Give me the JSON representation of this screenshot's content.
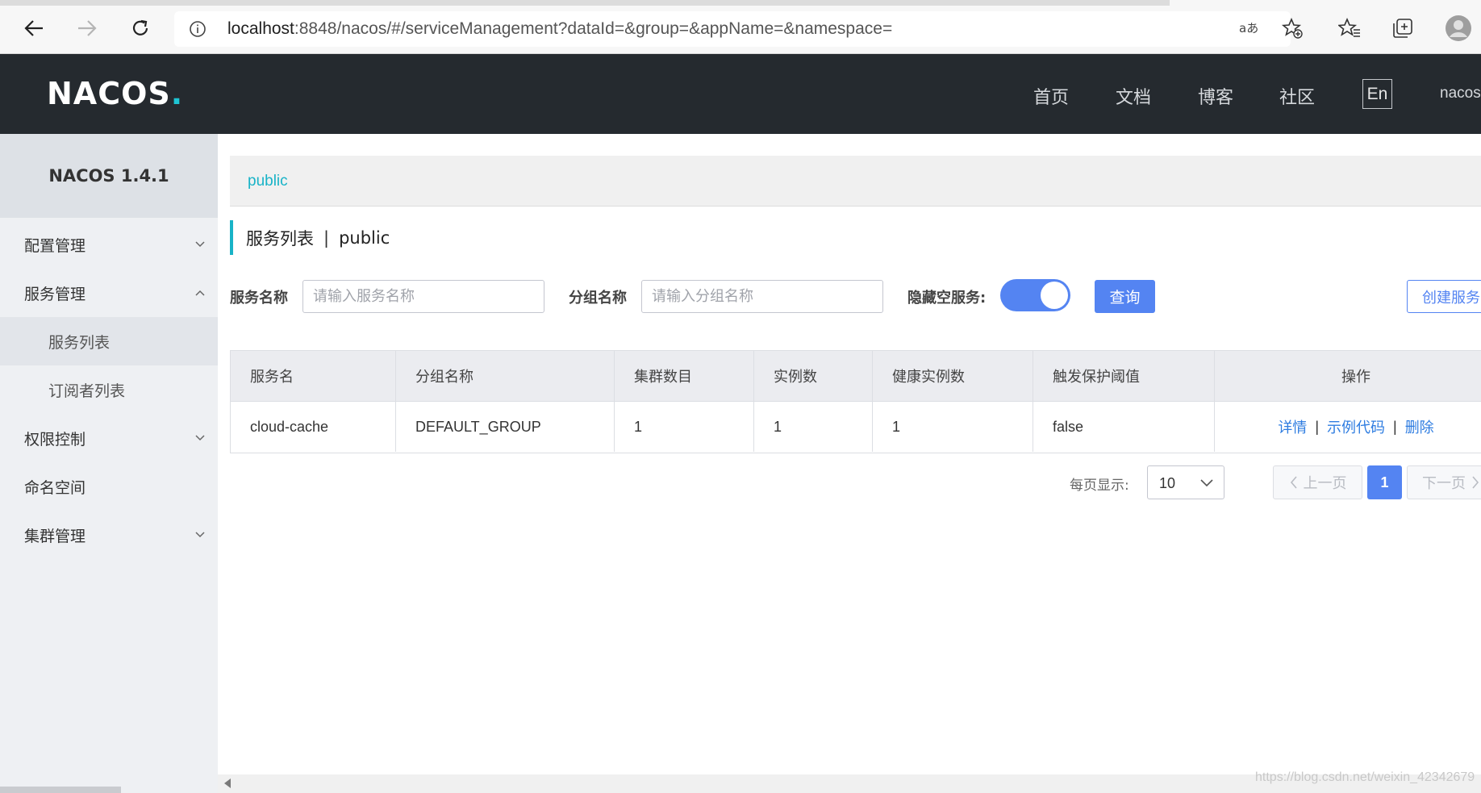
{
  "browser": {
    "url_host": "localhost",
    "url_rest": ":8848/nacos/#/serviceManagement?dataId=&group=&appName=&namespace="
  },
  "header": {
    "logo_text": "NACOS",
    "logo_dot": ".",
    "nav": [
      "首页",
      "文档",
      "博客",
      "社区"
    ],
    "lang_button": "En",
    "user": "nacos"
  },
  "sidebar": {
    "title": "NACOS 1.4.1",
    "items": [
      {
        "label": "配置管理",
        "chevron": "down"
      },
      {
        "label": "服务管理",
        "chevron": "up"
      },
      {
        "label": "服务列表",
        "sub": true,
        "active": true
      },
      {
        "label": "订阅者列表",
        "sub": true
      },
      {
        "label": "权限控制",
        "chevron": "down"
      },
      {
        "label": "命名空间"
      },
      {
        "label": "集群管理",
        "chevron": "down"
      }
    ]
  },
  "main": {
    "namespace_tab": "public",
    "title": "服务列表",
    "title_sep": "|",
    "title_namespace": "public",
    "filters": {
      "service_name_label": "服务名称",
      "service_name_placeholder": "请输入服务名称",
      "group_name_label": "分组名称",
      "group_name_placeholder": "请输入分组名称",
      "hide_empty_label": "隐藏空服务:",
      "hide_empty_on": true,
      "query_button": "查询",
      "create_button": "创建服务"
    },
    "table": {
      "columns": [
        "服务名",
        "分组名称",
        "集群数目",
        "实例数",
        "健康实例数",
        "触发保护阈值",
        "操作"
      ],
      "rows": [
        {
          "service": "cloud-cache",
          "group": "DEFAULT_GROUP",
          "clusters": "1",
          "instances": "1",
          "healthy": "1",
          "protect": "false"
        }
      ],
      "actions": [
        "详情",
        "示例代码",
        "删除"
      ],
      "action_sep": "|"
    },
    "pagination": {
      "page_size_label": "每页显示:",
      "page_size": "10",
      "prev": "上一页",
      "current": "1",
      "next": "下一页"
    }
  },
  "watermark": "https://blog.csdn.net/weixin_42342679",
  "colors": {
    "header_bg": "#252a2f",
    "accent": "#18b3c7",
    "primary": "#5484f2",
    "link": "#2f7de1",
    "sidebar_bg": "#eef0f3"
  }
}
